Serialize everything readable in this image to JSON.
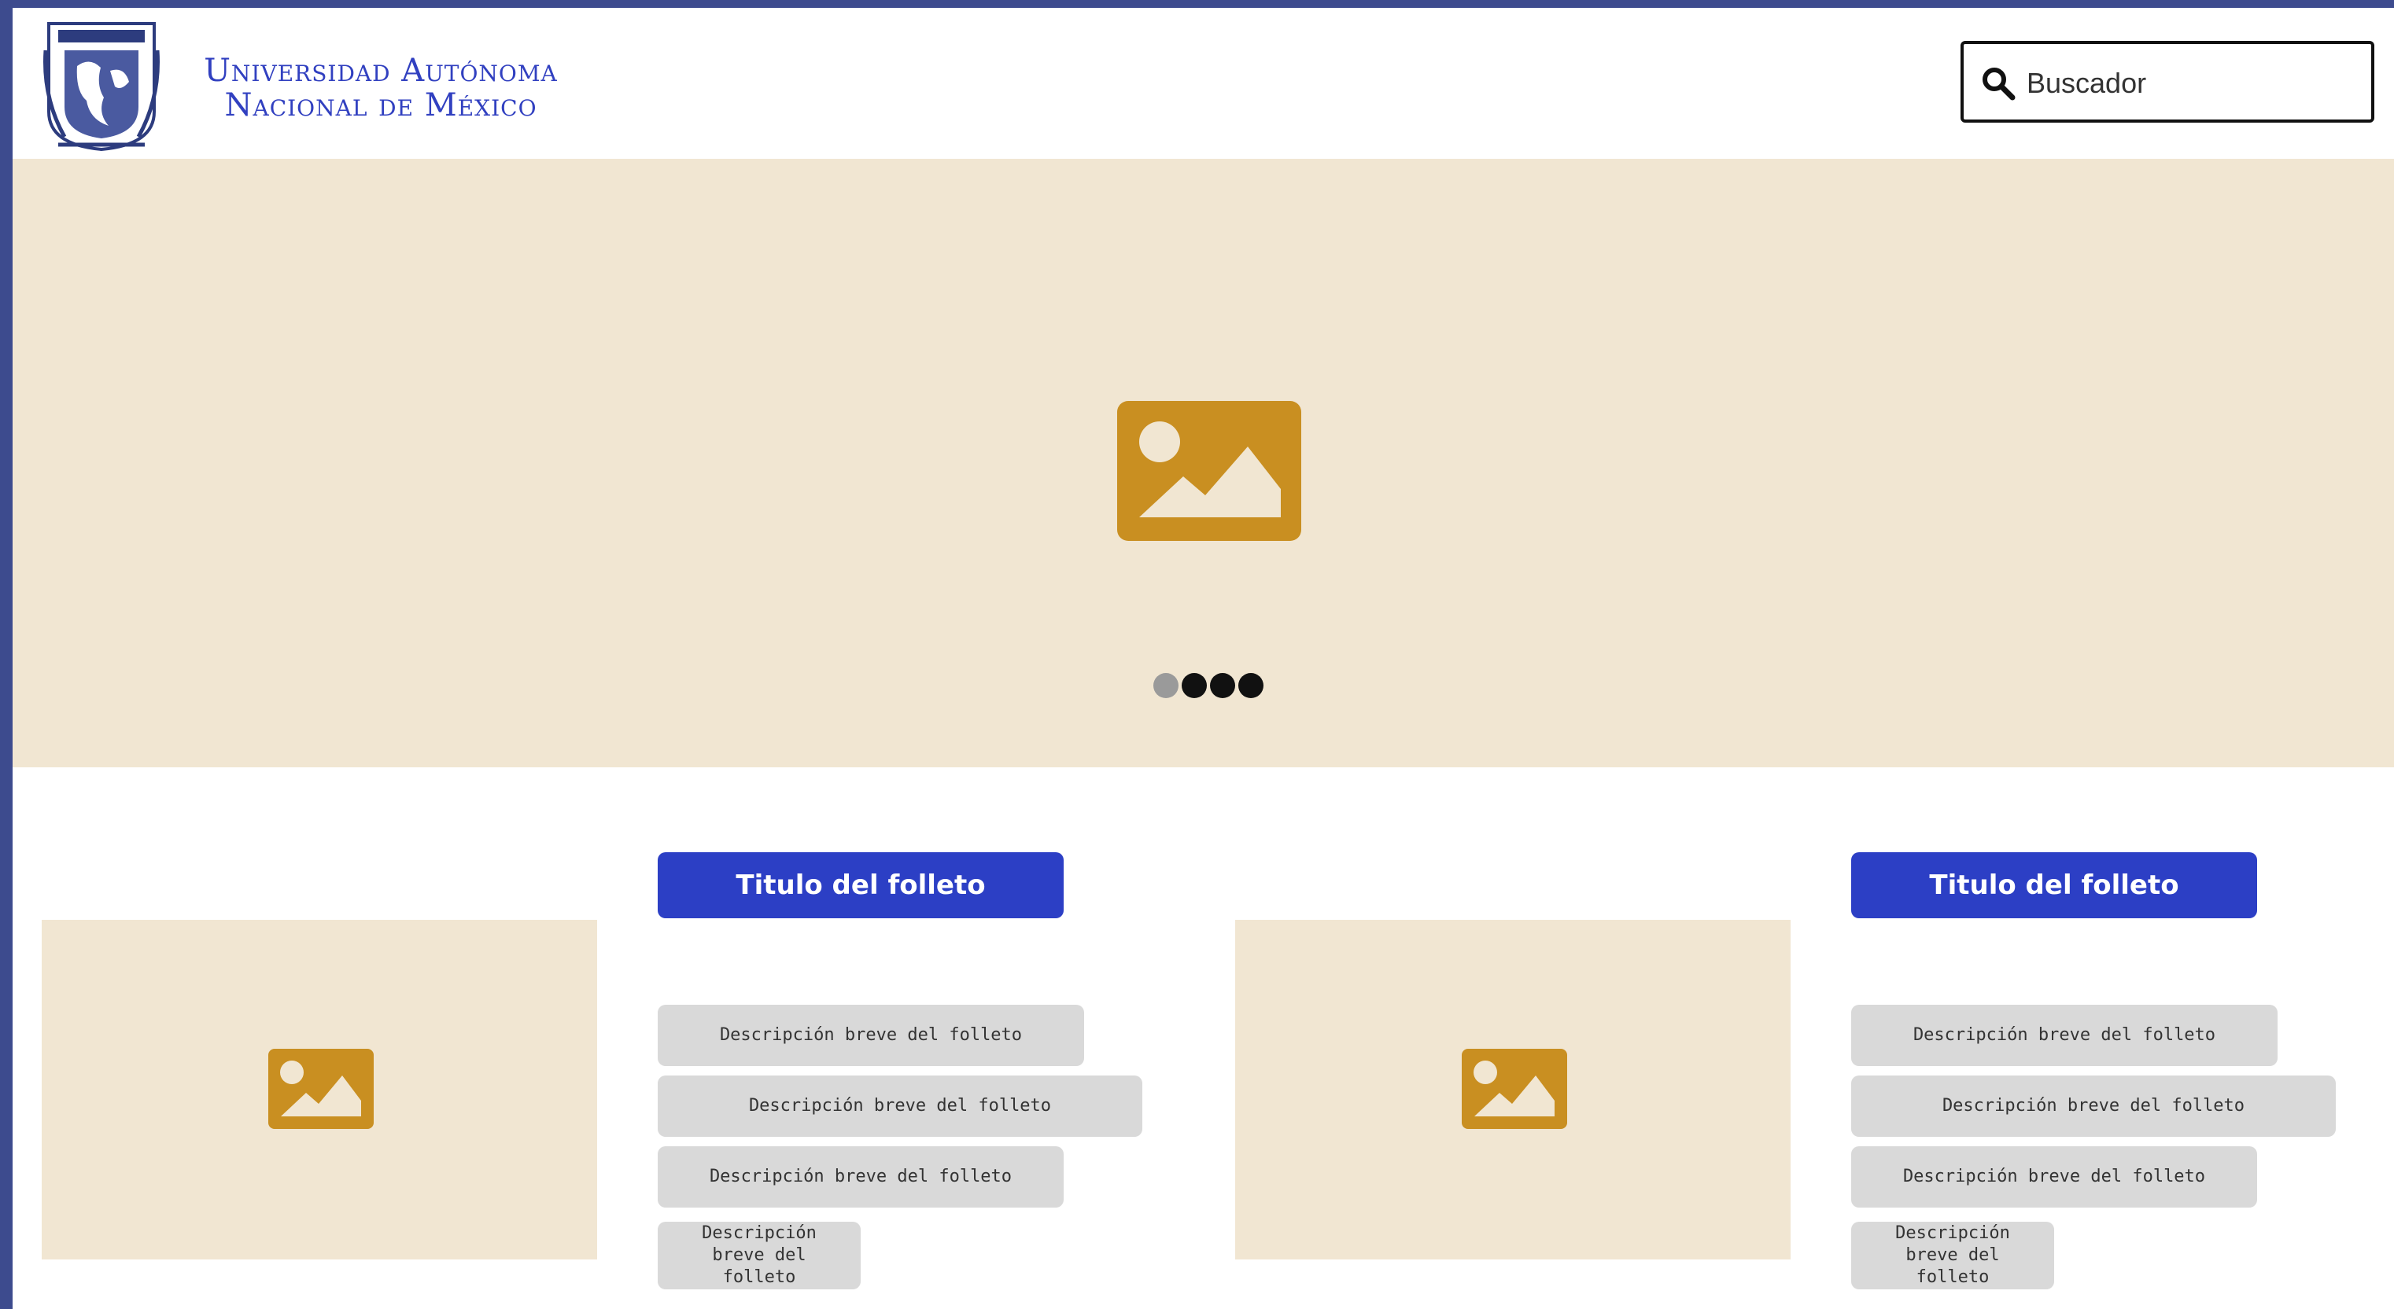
{
  "header": {
    "brand_line1": "Universidad Autónoma",
    "brand_line2": "Nacional de México",
    "logo_icon": "unam-crest-icon"
  },
  "search": {
    "placeholder": "Buscador",
    "icon": "search-icon"
  },
  "hero": {
    "icon": "image-placeholder-icon",
    "slides_total": 4,
    "active_slide": 1
  },
  "cards": [
    {
      "title": "Titulo del folleto",
      "descriptions": [
        "Descripción breve del folleto",
        "Descripción breve del folleto",
        "Descripción breve del folleto",
        "Descripción breve del folleto"
      ]
    },
    {
      "title": "Titulo del folleto",
      "descriptions": [
        "Descripción breve del folleto",
        "Descripción breve del folleto",
        "Descripción breve del folleto",
        "Descripción breve del folleto"
      ]
    }
  ],
  "colors": {
    "accent": "#2c3fc5",
    "brand_text": "#3140c0",
    "placeholder_bg": "#f1e6d2",
    "placeholder_icon": "#c98f21",
    "desc_bg": "#d9d9d9"
  }
}
